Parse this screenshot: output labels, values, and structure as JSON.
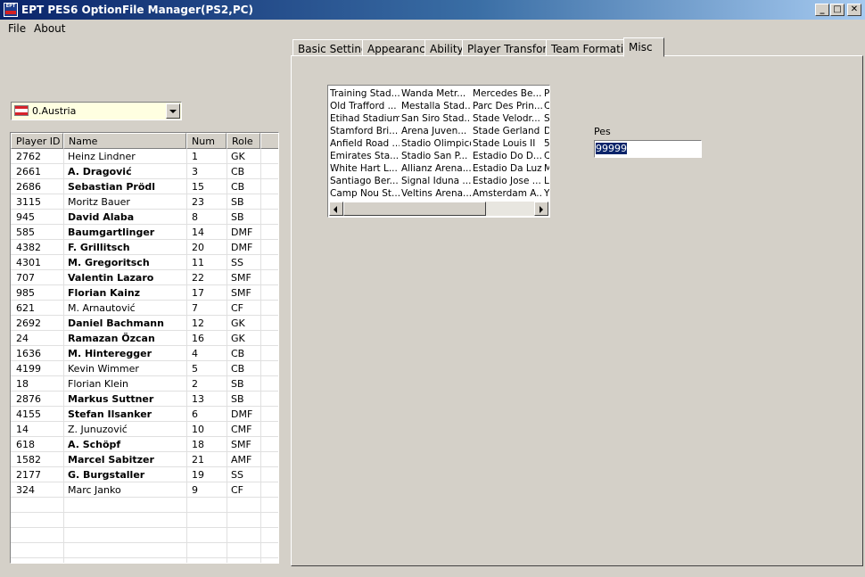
{
  "window": {
    "title": "EPT PES6 OptionFile Manager(PS2,PC)",
    "icon_text": "EPT",
    "controls": {
      "minimize": "_",
      "maximize": "□",
      "close": "✕"
    }
  },
  "menu": [
    "File",
    "About"
  ],
  "country": {
    "selected": "0.Austria",
    "flag": "austria-flag",
    "colors": [
      "#d8232a",
      "#ffffff"
    ]
  },
  "player_list": {
    "columns": [
      "Player ID",
      "Name",
      "Num",
      "Role"
    ],
    "rows": [
      {
        "id": "2762",
        "name": "Heinz Lindner",
        "num": "1",
        "role": "GK",
        "bold": false
      },
      {
        "id": "2661",
        "name": "A. Dragović",
        "num": "3",
        "role": "CB",
        "bold": true
      },
      {
        "id": "2686",
        "name": "Sebastian Prödl",
        "num": "15",
        "role": "CB",
        "bold": true
      },
      {
        "id": "3115",
        "name": "Moritz Bauer",
        "num": "23",
        "role": "SB",
        "bold": false
      },
      {
        "id": "945",
        "name": "David Alaba",
        "num": "8",
        "role": "SB",
        "bold": true
      },
      {
        "id": "585",
        "name": "Baumgartlinger",
        "num": "14",
        "role": "DMF",
        "bold": true
      },
      {
        "id": "4382",
        "name": "F. Grillitsch",
        "num": "20",
        "role": "DMF",
        "bold": true
      },
      {
        "id": "4301",
        "name": "M. Gregoritsch",
        "num": "11",
        "role": "SS",
        "bold": true
      },
      {
        "id": "707",
        "name": "Valentin Lazaro",
        "num": "22",
        "role": "SMF",
        "bold": true
      },
      {
        "id": "985",
        "name": "Florian Kainz",
        "num": "17",
        "role": "SMF",
        "bold": true
      },
      {
        "id": "621",
        "name": "M. Arnautović",
        "num": "7",
        "role": "CF",
        "bold": false
      },
      {
        "id": "2692",
        "name": "Daniel Bachmann",
        "num": "12",
        "role": "GK",
        "bold": true
      },
      {
        "id": "24",
        "name": "Ramazan Özcan",
        "num": "16",
        "role": "GK",
        "bold": true
      },
      {
        "id": "1636",
        "name": "M. Hinteregger",
        "num": "4",
        "role": "CB",
        "bold": true
      },
      {
        "id": "4199",
        "name": "Kevin Wimmer",
        "num": "5",
        "role": "CB",
        "bold": false
      },
      {
        "id": "18",
        "name": "Florian Klein",
        "num": "2",
        "role": "SB",
        "bold": false
      },
      {
        "id": "2876",
        "name": "Markus Suttner",
        "num": "13",
        "role": "SB",
        "bold": true
      },
      {
        "id": "4155",
        "name": "Stefan Ilsanker",
        "num": "6",
        "role": "DMF",
        "bold": true
      },
      {
        "id": "14",
        "name": "Z. Junuzović",
        "num": "10",
        "role": "CMF",
        "bold": false
      },
      {
        "id": "618",
        "name": "A. Schöpf",
        "num": "18",
        "role": "SMF",
        "bold": true
      },
      {
        "id": "1582",
        "name": "Marcel Sabitzer",
        "num": "21",
        "role": "AMF",
        "bold": true
      },
      {
        "id": "2177",
        "name": "G. Burgstaller",
        "num": "19",
        "role": "SS",
        "bold": true
      },
      {
        "id": "324",
        "name": "Marc Janko",
        "num": "9",
        "role": "CF",
        "bold": false
      }
    ]
  },
  "tabs": {
    "items": [
      "Basic Settings",
      "Appearance",
      "Ability",
      "Player Transform",
      "Team Formation",
      "Misc"
    ],
    "active": "Misc"
  },
  "misc": {
    "stadiums": [
      [
        "Training Stad...",
        "Wanda Metr...",
        "Mercedes Be...",
        "P"
      ],
      [
        "Old Trafford ...",
        "Mestalla Stad...",
        "Parc Des Prin...",
        "C"
      ],
      [
        "Etihad Stadium",
        "San Siro Stad...",
        "Stade Velodr...",
        "S"
      ],
      [
        "Stamford Bri...",
        "Arena Juven...",
        "Stade Gerland",
        "D"
      ],
      [
        "Anfield Road ...",
        "Stadio Olimpico",
        "Stade Louis II",
        "5"
      ],
      [
        "Emirates Sta...",
        "Stadio San P...",
        "Estadio Do D...",
        "C"
      ],
      [
        "White Hart L...",
        "Allianz Arena...",
        "Estadio Da Luz",
        "M"
      ],
      [
        "Santiago Ber...",
        "Signal Iduna ...",
        "Estadio Jose ...",
        "L"
      ],
      [
        "Camp Nou St...",
        "Veltins Arena...",
        "Amsterdam A...",
        "Y"
      ]
    ],
    "pes_label": "Pes",
    "pes_value": "99999"
  }
}
